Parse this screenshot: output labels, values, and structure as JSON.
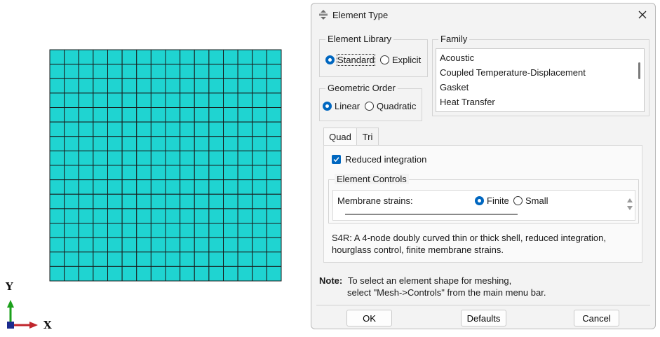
{
  "viewport": {
    "mesh": {
      "rows": 16,
      "cols": 16,
      "fill_color": "#1fd4d1",
      "line_color": "#1a1a1a"
    },
    "triad": {
      "y_label": "Y",
      "x_label": "X",
      "y_color": "#1ba01b",
      "x_color": "#c0262c",
      "origin_color": "#1b2c8e"
    }
  },
  "dialog": {
    "title": "Element Type",
    "title_icon": "element-type-icon",
    "close_icon": "close-icon",
    "element_library": {
      "title": "Element Library",
      "options": [
        {
          "label": "Standard",
          "selected": true
        },
        {
          "label": "Explicit",
          "selected": false
        }
      ]
    },
    "geometric_order": {
      "title": "Geometric Order",
      "options": [
        {
          "label": "Linear",
          "selected": true
        },
        {
          "label": "Quadratic",
          "selected": false
        }
      ]
    },
    "family": {
      "title": "Family",
      "items": [
        "Acoustic",
        "Coupled Temperature-Displacement",
        "Gasket",
        "Heat Transfer"
      ]
    },
    "tabs": [
      {
        "label": "Quad",
        "active": true
      },
      {
        "label": "Tri",
        "active": false
      }
    ],
    "reduced_integration": {
      "label": "Reduced integration",
      "checked": true
    },
    "element_controls": {
      "title": "Element Controls",
      "row_label": "Membrane strains:",
      "options": [
        {
          "label": "Finite",
          "selected": true
        },
        {
          "label": "Small",
          "selected": false
        }
      ]
    },
    "description_line1": "S4R:  A 4-node doubly curved thin or thick shell, reduced integration,",
    "description_line2": "hourglass control, finite membrane strains.",
    "note_label": "Note:",
    "note_line1": "To select an element shape for meshing,",
    "note_line2": "select \"Mesh->Controls\" from the main menu bar.",
    "buttons": {
      "ok": "OK",
      "defaults": "Defaults",
      "cancel": "Cancel"
    },
    "accent_color": "#0067c0"
  }
}
